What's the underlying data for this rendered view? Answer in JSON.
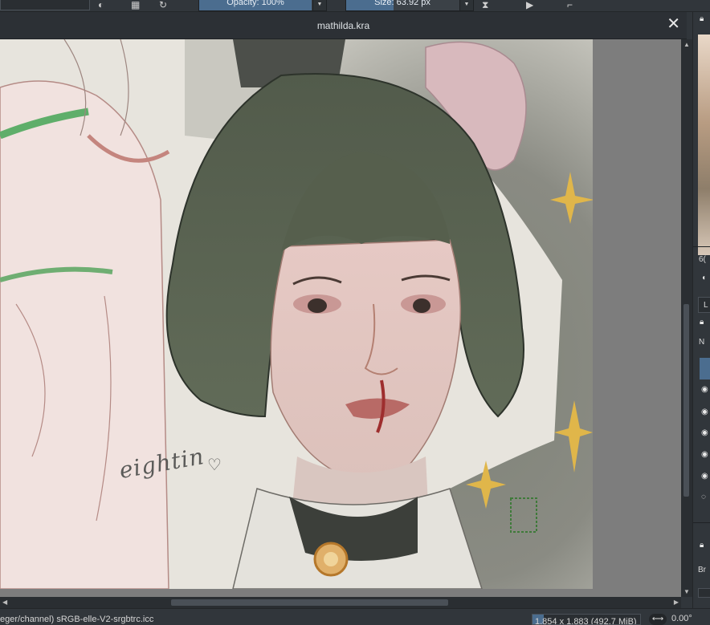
{
  "toolbar": {
    "opacity_label": "Opacity: 100%",
    "opacity_fraction": 1.0,
    "size_label": "Size: 63.92 px",
    "size_fraction": 0.42
  },
  "document": {
    "title": "mathilda.kra",
    "signature_text": "eightin"
  },
  "statusbar": {
    "colorspace": "eger/channel)  sRGB-elle-V2-srgbtrc.icc",
    "image_size": "1,854 x 1,883 (492.7 MiB)",
    "rotation": "0.00°"
  },
  "docker": {
    "zoom_fragment": "6(",
    "blend_fragment": "N",
    "brush_fragment": "Br",
    "lock_fragment": "L"
  },
  "colors": {
    "accent": "#4b6d8f",
    "panel": "#31363b",
    "hair": "#5a6453",
    "sparkle": "#e0b64a"
  }
}
